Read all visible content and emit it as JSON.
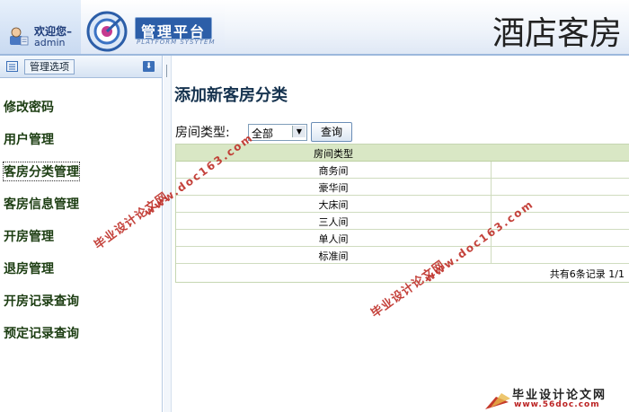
{
  "header": {
    "welcome": "欢迎您–",
    "username": "admin",
    "platform_title": "管理平台",
    "platform_subtitle": "PLATFORM SYSYTEM",
    "system_title": "酒店客房"
  },
  "sidebar": {
    "title": "管理选项",
    "items": [
      {
        "label": "修改密码"
      },
      {
        "label": "用户管理"
      },
      {
        "label": "客房分类管理"
      },
      {
        "label": "客房信息管理"
      },
      {
        "label": "开房管理"
      },
      {
        "label": "退房管理"
      },
      {
        "label": "开房记录查询"
      },
      {
        "label": "预定记录查询"
      }
    ],
    "active_index": 2
  },
  "main": {
    "page_title": "添加新客房分类",
    "filter": {
      "label": "房间类型:",
      "selected": "全部",
      "button": "查询"
    },
    "table": {
      "column_header": "房间类型",
      "rows": [
        "商务间",
        "豪华间",
        "大床间",
        "三人间",
        "单人间",
        "标准间"
      ],
      "pager": "共有6条记录  1/1"
    }
  },
  "watermarks": {
    "cn": "毕业设计论文网",
    "url": "www.doc163.com",
    "corner_cn": "毕业设计论文网",
    "corner_url": "www.56doc.com"
  },
  "colors": {
    "accent": "#2c5ea8",
    "grid_header": "#d9e7c5",
    "watermark": "#c0322b"
  }
}
